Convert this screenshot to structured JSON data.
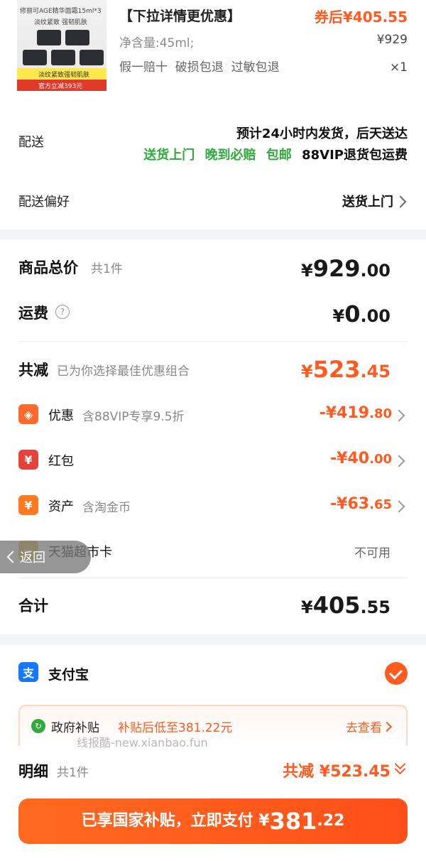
{
  "product": {
    "title": "【下拉详情更优惠】",
    "image_top_text": "修丽可AGE精华面霜15ml*3",
    "image_mid_text": "淡纹紧致 强韧肌肤",
    "image_strip_text": "淡纹紧致强韧肌肤",
    "image_bottom_text": "官方立减393元",
    "spec": "净含量:45ml;",
    "guarantees": "假一赔十  破损包退  过敏包退",
    "coupon_price_label": "券后¥405.55",
    "original_price": "¥929",
    "quantity": "×1"
  },
  "delivery": {
    "label": "配送",
    "estimate": "预计24小时内发货，后天送达",
    "tag_door": "送货上门",
    "tag_late": "晚到必赔",
    "tag_free": "包邮",
    "tag_vip": "88VIP退货包运费",
    "pref_label": "配送偏好",
    "pref_value": "送货上门"
  },
  "summary": {
    "total_label": "商品总价",
    "total_count": "共1件",
    "total_yen": "¥",
    "total_int": "929",
    "total_dec": ".00",
    "ship_label": "运费",
    "ship_yen": "¥",
    "ship_int": "0",
    "ship_dec": ".00",
    "reduce_label": "共减",
    "reduce_note": "已为你选择最佳优惠组合",
    "reduce_yen": "¥",
    "reduce_int": "523",
    "reduce_dec": ".45",
    "discount_label": "优惠",
    "discount_note": "含88VIP专享9.5折",
    "discount_value_main": "-¥419",
    "discount_value_dec": ".80",
    "redpacket_label": "红包",
    "redpacket_value_main": "-¥40",
    "redpacket_value_dec": ".00",
    "asset_label": "资产",
    "asset_note": "含淘金币",
    "asset_value_main": "-¥63",
    "asset_value_dec": ".65",
    "card_label": "天猫超市卡",
    "card_value": "不可用",
    "back_label": "返回",
    "sum_label": "合计",
    "sum_yen": "¥",
    "sum_int": "405",
    "sum_dec": ".55"
  },
  "payment": {
    "method": "支付宝",
    "subsidy_label": "政府补贴",
    "subsidy_note": "补贴后低至381.22元",
    "subsidy_link": "去查看",
    "watermark": "线报酷-new.xianbao.fun"
  },
  "footer": {
    "detail_label": "明细",
    "detail_count": "共1件",
    "detail_reduce": "共减 ¥523.45",
    "pay_button_text": "已享国家补贴，立即支付 ¥",
    "pay_int": "381",
    "pay_dec": ".22"
  },
  "colors": {
    "accent": "#ff5a1f",
    "green": "#2faa3b",
    "alipay": "#1677ff",
    "red_packet": "#e8413a",
    "card_yellow": "#d9b43b"
  }
}
